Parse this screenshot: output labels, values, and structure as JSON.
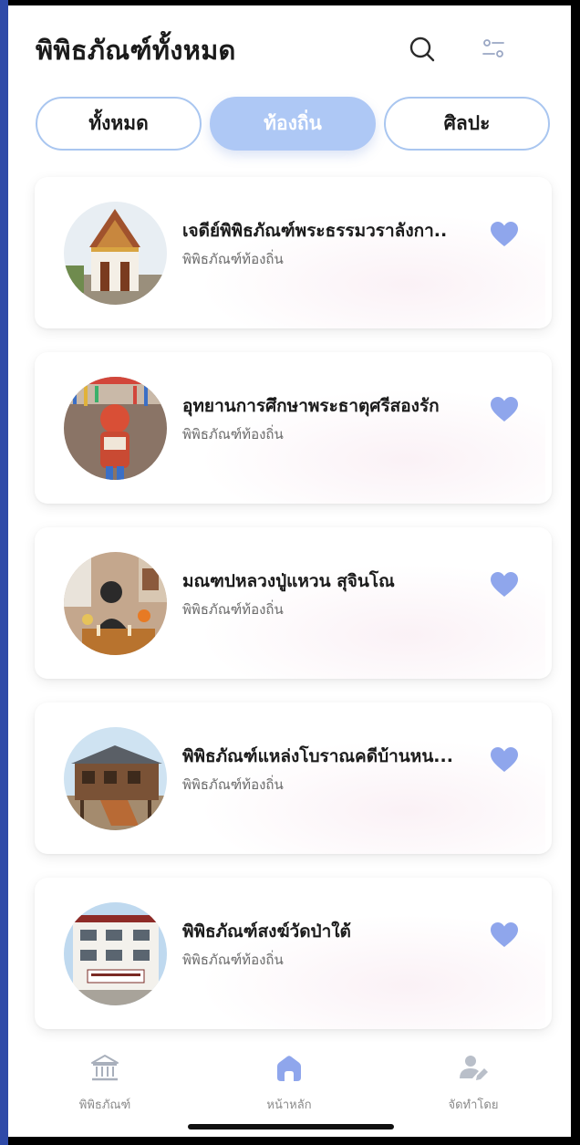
{
  "header": {
    "title": "พิพิธภัณฑ์ทั้งหมด",
    "search_icon": "search-icon",
    "filter_icon": "sliders-icon"
  },
  "tabs": [
    {
      "label": "ทั้งหมด",
      "active": false
    },
    {
      "label": "ท้องถิ่น",
      "active": true
    },
    {
      "label": "ศิลปะ",
      "active": false
    }
  ],
  "museums": [
    {
      "title": "เจดีย์พิพิธภัณฑ์พระธรรมวราลังกา..",
      "category": "พิพิธภัณฑ์ท้องถิ่น",
      "favorite": true
    },
    {
      "title": "อุทยานการศึกษาพระธาตุศรีสองรัก",
      "category": "พิพิธภัณฑ์ท้องถิ่น",
      "favorite": true
    },
    {
      "title": "มณฑปหลวงปู่แหวน สุจินโณ",
      "category": "พิพิธภัณฑ์ท้องถิ่น",
      "favorite": true
    },
    {
      "title": "พิพิธภัณฑ์แหล่งโบราณคดีบ้านหน...",
      "category": "พิพิธภัณฑ์ท้องถิ่น",
      "favorite": true
    },
    {
      "title": "พิพิธภัณฑ์สงฆ์วัดป่าใต้",
      "category": "พิพิธภัณฑ์ท้องถิ่น",
      "favorite": true
    }
  ],
  "bottom_nav": [
    {
      "label": "พิพิธภัณฑ์",
      "icon": "museum-icon",
      "active": false
    },
    {
      "label": "หน้าหลัก",
      "icon": "home-icon",
      "active": true
    },
    {
      "label": "จัดทำโดย",
      "icon": "user-edit-icon",
      "active": false
    }
  ],
  "colors": {
    "accent": "#8fa6ec",
    "tab_active_bg": "#aec8f5",
    "tab_border": "#a9c6f0",
    "heart": "#8fa6ec",
    "nav_inactive": "#b9bfc9"
  }
}
